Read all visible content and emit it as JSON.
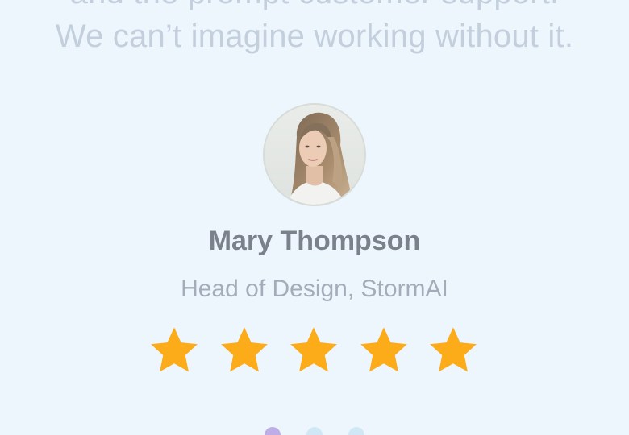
{
  "testimonial": {
    "quote_lines": [
      "and the prompt customer support.",
      "We can’t imagine working without it."
    ],
    "author_name": "Mary Thompson",
    "author_role": "Head of Design, StormAI",
    "rating": 5,
    "rating_max": 5
  },
  "carousel": {
    "slide_count": 3,
    "active_index": 0
  },
  "colors": {
    "background": "#eef6fd",
    "quote_text": "#c3cfdc",
    "name_text": "#7a818b",
    "role_text": "#a3adb9",
    "star": "#fcab19",
    "dot_active": "#bdaee6",
    "dot_inactive": "#d0e8f5"
  },
  "icons": {
    "star": "star-icon",
    "avatar": "person-photo"
  }
}
